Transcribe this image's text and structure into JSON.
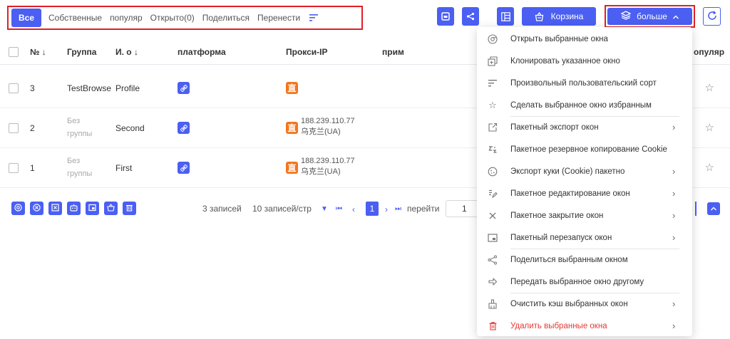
{
  "tabs": {
    "all": "Все",
    "own": "Собственные",
    "popular": "популяр",
    "opened": "Открыто(0)",
    "shared": "Поделиться",
    "transfer": "Перенести"
  },
  "toolbar": {
    "trash_label": "Корзина",
    "more_label": "больше",
    "accent": "#4b5ff2",
    "highlight": "#e01f26"
  },
  "table": {
    "headers": {
      "no": "№ ↓",
      "group": "Группа",
      "name": "И. о ↓",
      "platform": "платформа",
      "proxy": "Прокси-IP",
      "note": "прим",
      "popular": "опуляр"
    },
    "rows": [
      {
        "no": "3",
        "group_line1": "TestBrowse",
        "group_line2": "",
        "name": "Profile",
        "ip": "",
        "ip_region": ""
      },
      {
        "no": "2",
        "group_line1": "Без",
        "group_line2": "группы",
        "name": "Second",
        "ip": "188.239.110.77",
        "ip_region": "乌克兰(UA)"
      },
      {
        "no": "1",
        "group_line1": "Без",
        "group_line2": "группы",
        "name": "First",
        "ip": "188.239.110.77",
        "ip_region": "乌克兰(UA)"
      }
    ],
    "proxy_badge": "直"
  },
  "pager": {
    "records": "3 записей",
    "per_page": "10 записей/стр",
    "current": "1",
    "goto_label": "перейти",
    "goto_value": "1"
  },
  "menu": {
    "items": [
      {
        "label": "Открыть выбранные окна",
        "icon": "chrome-icon"
      },
      {
        "label": "Клонировать указанное окно",
        "icon": "clone-icon"
      },
      {
        "label": "Произвольный пользовательский сорт",
        "icon": "sort-icon"
      },
      {
        "label": "Сделать выбранное окно избранным",
        "icon": "star-icon"
      },
      {
        "label": "Пакетный экспорт окон",
        "icon": "export-icon"
      },
      {
        "label": "Пакетное резервное копирование Cookie",
        "icon": "backup-icon"
      },
      {
        "label": "Экспорт куки (Cookie) пакетно",
        "icon": "cookie-icon"
      },
      {
        "label": "Пакетное редактирование окон",
        "icon": "edit-icon"
      },
      {
        "label": "Пакетное закрытие окон",
        "icon": "close-icon"
      },
      {
        "label": "Пакетный перезапуск окон",
        "icon": "restart-icon"
      },
      {
        "label": "Поделиться выбранным окном",
        "icon": "share-icon"
      },
      {
        "label": "Передать выбранное окно другому",
        "icon": "transfer-icon"
      },
      {
        "label": "Очистить кэш выбранных окон",
        "icon": "broom-icon"
      },
      {
        "label": "Удалить выбранные окна",
        "icon": "trash-icon"
      }
    ]
  }
}
